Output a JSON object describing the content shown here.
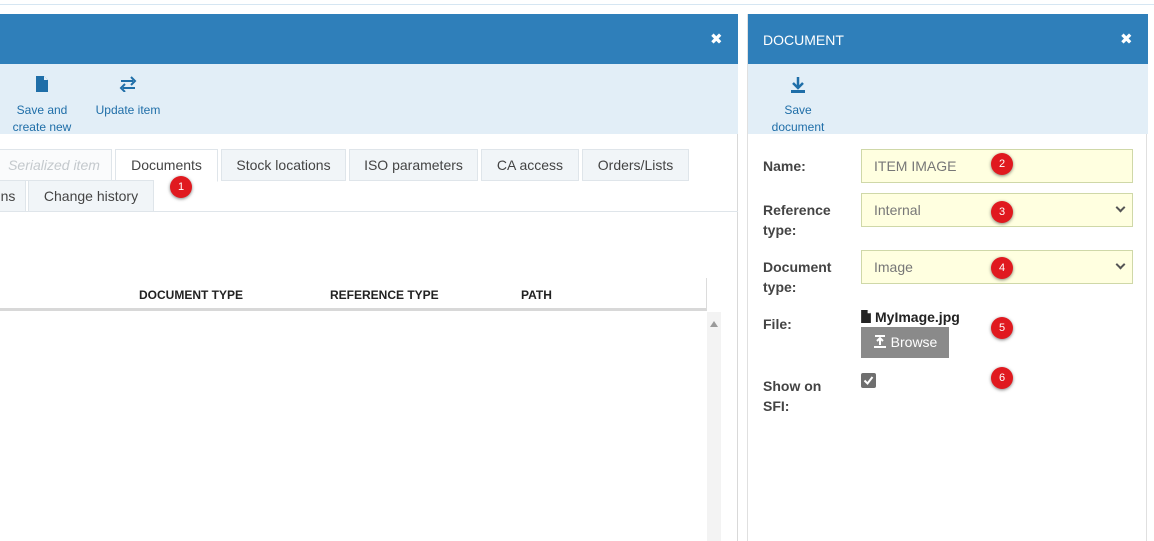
{
  "left_panel": {
    "close_icon": "close-icon",
    "toolbar": {
      "save_new_line1": "Save and",
      "save_new_line2": "create new",
      "update_label": "Update item"
    },
    "tabs": {
      "serialized": "Serialized item",
      "documents": "Documents",
      "stock_locations": "Stock locations",
      "iso_parameters": "ISO parameters",
      "ca_access": "CA access",
      "orders_lists": "Orders/Lists",
      "partial": "ns",
      "change_history": "Change history"
    },
    "table": {
      "columns": [
        "DOCUMENT TYPE",
        "REFERENCE TYPE",
        "PATH"
      ]
    }
  },
  "right_panel": {
    "title": "DOCUMENT",
    "toolbar": {
      "save_line1": "Save",
      "save_line2": "document"
    },
    "form": {
      "name_label": "Name:",
      "name_value": "ITEM IMAGE",
      "ref_label_1": "Reference",
      "ref_label_2": "type:",
      "ref_value": "Internal",
      "doc_label_1": "Document",
      "doc_label_2": "type:",
      "doc_value": "Image",
      "file_label": "File:",
      "file_name": "MyImage.jpg",
      "browse_label": "Browse",
      "sfi_label_1": "Show on",
      "sfi_label_2": "SFI:",
      "show_on_sfi": true
    }
  },
  "badges": [
    "1",
    "2",
    "3",
    "4",
    "5",
    "6"
  ],
  "colors": {
    "header_blue": "#2f7fba",
    "toolbar_bg": "#e2eef7",
    "badge_red": "#e0191f",
    "input_bg": "#ffffe0"
  }
}
